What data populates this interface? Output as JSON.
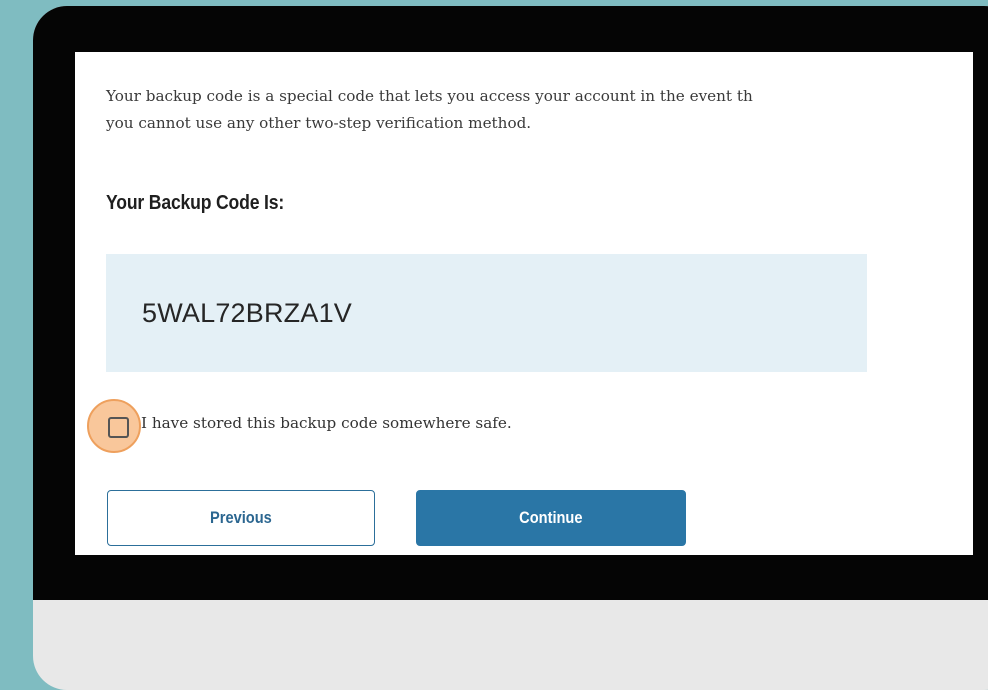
{
  "intro": {
    "line1": "Your backup code is a special code that lets you access your account in the event th",
    "line2": "you cannot use any other two-step verification method."
  },
  "backup": {
    "heading": "Your Backup Code Is:",
    "code": "5WAL72BRZA1V"
  },
  "confirm": {
    "label": "I have stored this backup code somewhere safe.",
    "checked": false
  },
  "buttons": {
    "previous": "Previous",
    "continue": "Continue"
  },
  "colors": {
    "background": "#7fbcc1",
    "bezel": "#050505",
    "chin": "#e8e8e8",
    "code_box": "#e4f0f6",
    "primary": "#2a76a6",
    "highlight": "#f7b275"
  }
}
